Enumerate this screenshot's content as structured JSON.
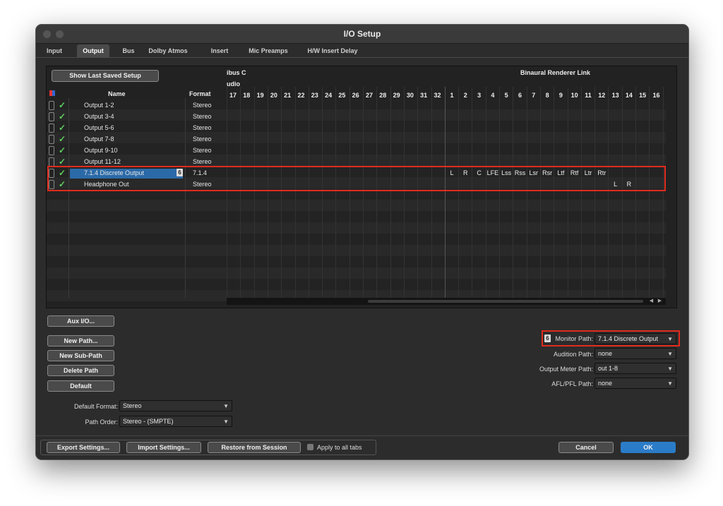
{
  "window": {
    "title": "I/O Setup"
  },
  "tabs": [
    "Input",
    "Output",
    "Bus",
    "Dolby Atmos",
    "Insert",
    "Mic Preamps",
    "H/W Insert Delay"
  ],
  "active_tab": "Output",
  "show_last_saved_label": "Show Last Saved Setup",
  "columns": {
    "name": "Name",
    "format": "Format"
  },
  "group_headers": {
    "left_line1": "ibus C",
    "left_line2": "udio",
    "right": "Binaural Renderer Link"
  },
  "channel_numbers_left": [
    "17",
    "18",
    "19",
    "20",
    "21",
    "22",
    "23",
    "24",
    "25",
    "26",
    "27",
    "28",
    "29",
    "30",
    "31",
    "32"
  ],
  "channel_numbers_right": [
    "1",
    "2",
    "3",
    "4",
    "5",
    "6",
    "7",
    "8",
    "9",
    "10",
    "11",
    "12",
    "13",
    "14",
    "15",
    "16"
  ],
  "outputs": [
    {
      "name": "Output 1-2",
      "format": "Stereo"
    },
    {
      "name": "Output 3-4",
      "format": "Stereo"
    },
    {
      "name": "Output 5-6",
      "format": "Stereo"
    },
    {
      "name": "Output 7-8",
      "format": "Stereo"
    },
    {
      "name": "Output 9-10",
      "format": "Stereo"
    },
    {
      "name": "Output 11-12",
      "format": "Stereo"
    },
    {
      "name": "7.1.4 Discrete Output",
      "format": "7.1.4"
    },
    {
      "name": "Headphone Out",
      "format": "Stereo"
    }
  ],
  "selected_row_monitor_icon": "6",
  "channel_map_714": [
    "L",
    "R",
    "C",
    "LFE",
    "Lss",
    "Rss",
    "Lsr",
    "Rsr",
    "Ltf",
    "Rtf",
    "Ltr",
    "Rtr"
  ],
  "channel_map_headphone": [
    "L",
    "R"
  ],
  "buttons_left": [
    "Aux I/O...",
    "New Path...",
    "New Sub-Path",
    "Delete Path",
    "Default"
  ],
  "default_format": {
    "label": "Default Format:",
    "value": "Stereo"
  },
  "path_order": {
    "label": "Path Order:",
    "value": "Stereo - (SMPTE)"
  },
  "monitor_path": {
    "icon": "6",
    "label": "Monitor Path:",
    "value": "7.1.4 Discrete Output"
  },
  "audition_path": {
    "label": "Audition Path:",
    "value": "none"
  },
  "output_meter_path": {
    "label": "Output Meter Path:",
    "value": "out 1-8"
  },
  "aflpfl_path": {
    "label": "AFL/PFL Path:",
    "value": "none"
  },
  "footer": {
    "export": "Export Settings...",
    "import": "Import Settings...",
    "restore": "Restore from Session",
    "apply_all": "Apply to all tabs",
    "cancel": "Cancel",
    "ok": "OK"
  },
  "colors": {
    "accent": "#2b7cc8",
    "highlight": "#e12b1e",
    "check": "#5ed25e"
  }
}
